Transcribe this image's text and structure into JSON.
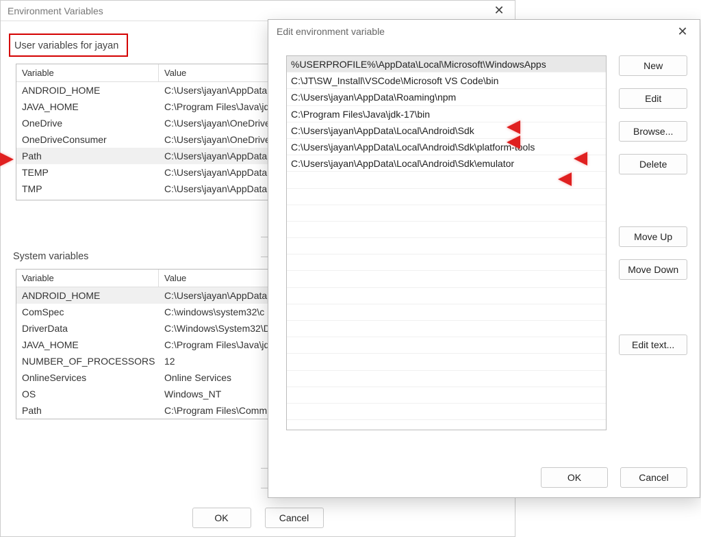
{
  "env_dialog": {
    "title": "Environment Variables",
    "user_section_label": "User variables for jayan",
    "col_variable": "Variable",
    "col_value": "Value",
    "user_vars": [
      {
        "name": "ANDROID_HOME",
        "value": "C:\\Users\\jayan\\AppData"
      },
      {
        "name": "JAVA_HOME",
        "value": "C:\\Program Files\\Java\\jd"
      },
      {
        "name": "OneDrive",
        "value": "C:\\Users\\jayan\\OneDrive"
      },
      {
        "name": "OneDriveConsumer",
        "value": "C:\\Users\\jayan\\OneDrive"
      },
      {
        "name": "Path",
        "value": "C:\\Users\\jayan\\AppData"
      },
      {
        "name": "TEMP",
        "value": "C:\\Users\\jayan\\AppData"
      },
      {
        "name": "TMP",
        "value": "C:\\Users\\jayan\\AppData"
      }
    ],
    "user_selected_index": 4,
    "sys_section_label": "System variables",
    "sys_vars": [
      {
        "name": "ANDROID_HOME",
        "value": "C:\\Users\\jayan\\AppData"
      },
      {
        "name": "ComSpec",
        "value": "C:\\windows\\system32\\c"
      },
      {
        "name": "DriverData",
        "value": "C:\\Windows\\System32\\D"
      },
      {
        "name": "JAVA_HOME",
        "value": "C:\\Program Files\\Java\\jd"
      },
      {
        "name": "NUMBER_OF_PROCESSORS",
        "value": "12"
      },
      {
        "name": "OnlineServices",
        "value": "Online Services"
      },
      {
        "name": "OS",
        "value": "Windows_NT"
      },
      {
        "name": "Path",
        "value": "C:\\Program Files\\Comm"
      }
    ],
    "sys_selected_index": 0,
    "ok_label": "OK",
    "cancel_label": "Cancel"
  },
  "edit_dialog": {
    "title": "Edit environment variable",
    "entries": [
      "%USERPROFILE%\\AppData\\Local\\Microsoft\\WindowsApps",
      "C:\\JT\\SW_Install\\VSCode\\Microsoft VS Code\\bin",
      "C:\\Users\\jayan\\AppData\\Roaming\\npm",
      "C:\\Program Files\\Java\\jdk-17\\bin",
      "C:\\Users\\jayan\\AppData\\Local\\Android\\Sdk",
      "C:\\Users\\jayan\\AppData\\Local\\Android\\Sdk\\platform-tools",
      "C:\\Users\\jayan\\AppData\\Local\\Android\\Sdk\\emulator"
    ],
    "selected_index": 0,
    "buttons": {
      "new_": "New",
      "edit": "Edit",
      "browse": "Browse...",
      "delete_": "Delete",
      "move_up": "Move Up",
      "move_down": "Move Down",
      "edit_text": "Edit text...",
      "ok": "OK",
      "cancel": "Cancel"
    }
  }
}
